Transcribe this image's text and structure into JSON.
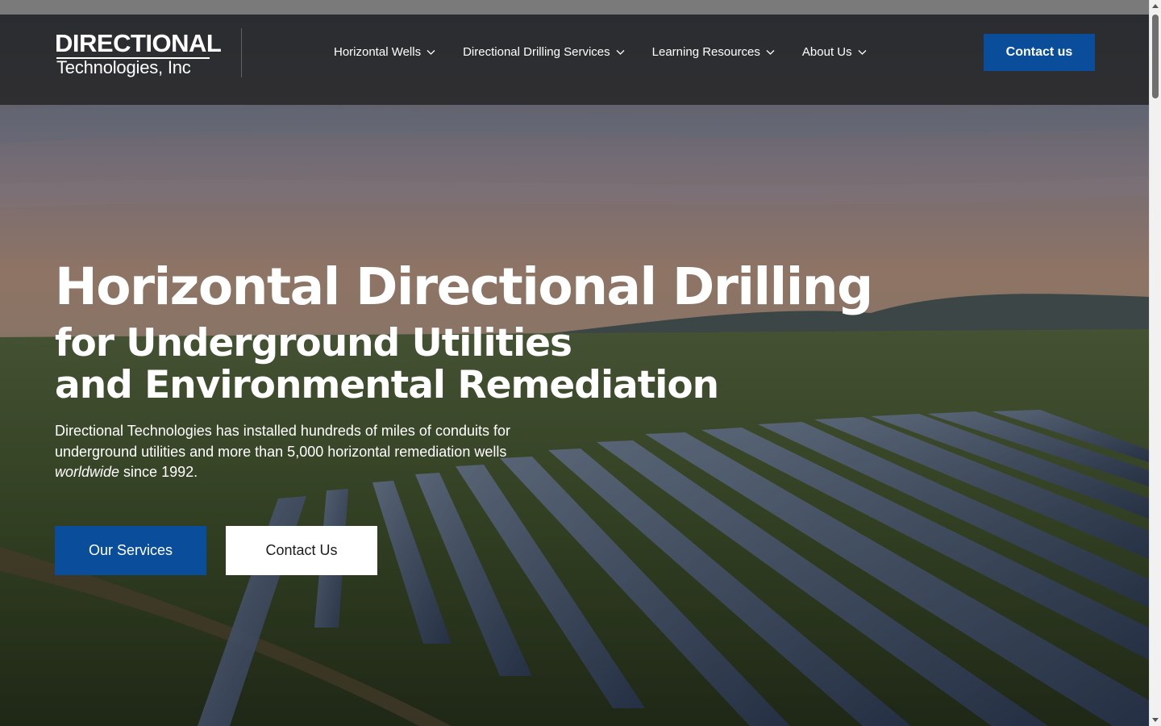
{
  "brand": {
    "line1": "DIRECTIONAL",
    "line2": "Technologies, Inc"
  },
  "nav": {
    "items": [
      {
        "label": "Horizontal Wells",
        "icon": "chevron-down-icon"
      },
      {
        "label": "Directional Drilling Services",
        "icon": "chevron-down-icon"
      },
      {
        "label": "Learning Resources",
        "icon": "chevron-down-icon"
      },
      {
        "label": "About Us",
        "icon": "chevron-down-icon"
      }
    ],
    "contact_label": "Contact us"
  },
  "hero": {
    "title": "Horizontal Directional Drilling",
    "subtitle_line1": "for Underground Utilities",
    "subtitle_line2": "and Environmental Remediation",
    "lede_start": "Directional Technologies has installed hundreds of miles of conduits for underground utilities and more than 5,000 horizontal remediation wells ",
    "lede_em": "worldwide",
    "lede_end": " since 1992.",
    "buttons": {
      "primary": "Our Services",
      "secondary": "Contact Us"
    }
  },
  "colors": {
    "accent": "#0a4d9b",
    "header_bg": "#262628",
    "text_on_dark": "#ffffff"
  }
}
